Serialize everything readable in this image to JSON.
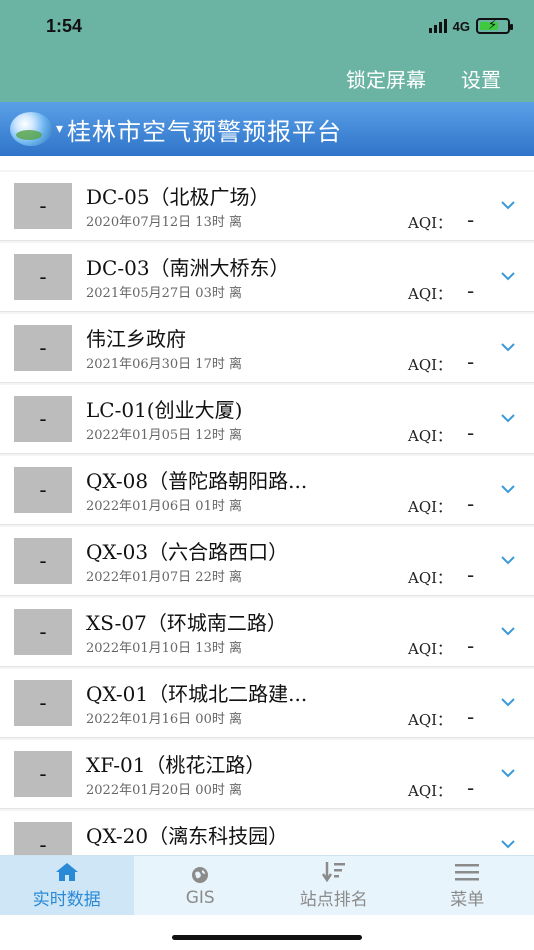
{
  "status": {
    "time": "1:54",
    "network": "4G"
  },
  "header": {
    "lock_label": "锁定屏幕",
    "settings_label": "设置",
    "title": "桂林市空气预警预报平台"
  },
  "stations": [
    {
      "aqi_box": "-",
      "name": "DC-05（北极广场）",
      "time": "2020年07月12日 13时 离",
      "aqi_label": "AQI：",
      "aqi_value": "-"
    },
    {
      "aqi_box": "-",
      "name": "DC-03（南洲大桥东）",
      "time": "2021年05月27日 03时 离",
      "aqi_label": "AQI：",
      "aqi_value": "-"
    },
    {
      "aqi_box": "-",
      "name": "伟江乡政府",
      "time": "2021年06月30日 17时 离",
      "aqi_label": "AQI：",
      "aqi_value": "-"
    },
    {
      "aqi_box": "-",
      "name": "LC-01(创业大厦)",
      "time": "2022年01月05日 12时 离",
      "aqi_label": "AQI：",
      "aqi_value": "-"
    },
    {
      "aqi_box": "-",
      "name": "QX-08（普陀路朝阳路...",
      "time": "2022年01月06日 01时 离",
      "aqi_label": "AQI：",
      "aqi_value": "-"
    },
    {
      "aqi_box": "-",
      "name": "QX-03（六合路西口）",
      "time": "2022年01月07日 22时 离",
      "aqi_label": "AQI：",
      "aqi_value": "-"
    },
    {
      "aqi_box": "-",
      "name": "XS-07（环城南二路）",
      "time": "2022年01月10日 13时 离",
      "aqi_label": "AQI：",
      "aqi_value": "-"
    },
    {
      "aqi_box": "-",
      "name": "QX-01（环城北二路建...",
      "time": "2022年01月16日 00时 离",
      "aqi_label": "AQI：",
      "aqi_value": "-"
    },
    {
      "aqi_box": "-",
      "name": "XF-01（桃花江路）",
      "time": "2022年01月20日 00时 离",
      "aqi_label": "AQI：",
      "aqi_value": "-"
    },
    {
      "aqi_box": "-",
      "name": "QX-20（漓东科技园）",
      "time": "",
      "aqi_label": "",
      "aqi_value": ""
    }
  ],
  "tabs": [
    {
      "label": "实时数据",
      "icon": "home-icon",
      "active": true
    },
    {
      "label": "GIS",
      "icon": "globe-icon",
      "active": false
    },
    {
      "label": "站点排名",
      "icon": "sort-icon",
      "active": false
    },
    {
      "label": "菜单",
      "icon": "menu-icon",
      "active": false
    }
  ],
  "colors": {
    "header_bg": "#6bb3a2",
    "title_bg": "#2f74c8",
    "tab_active": "#2b8ad6",
    "chevron": "#3a9ad9"
  }
}
